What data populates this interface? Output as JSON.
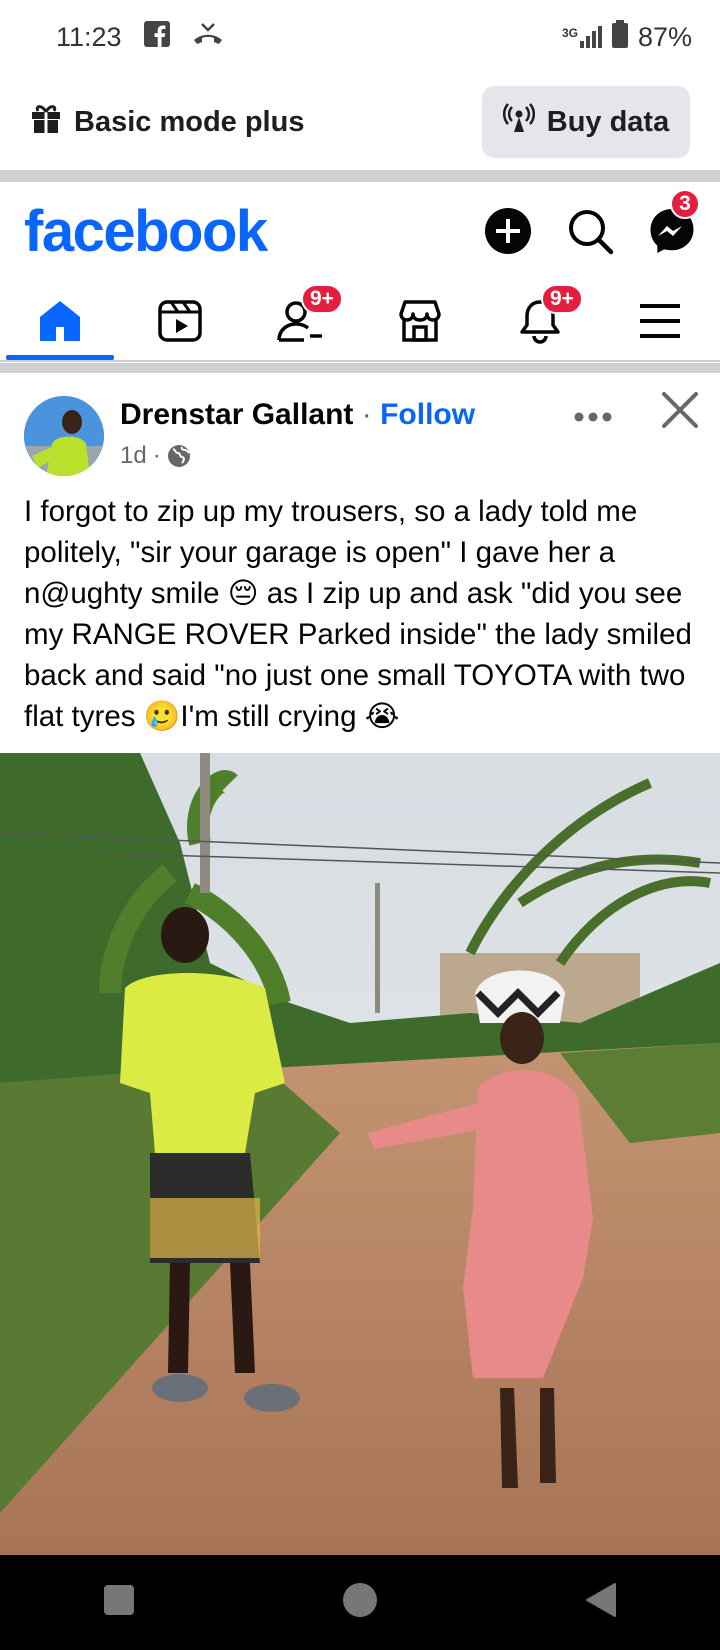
{
  "status_bar": {
    "time": "11:23",
    "network": "3G",
    "battery": "87%"
  },
  "mode_bar": {
    "label": "Basic mode plus",
    "buy_button": "Buy data"
  },
  "header": {
    "logo": "facebook",
    "messenger_badge": "3"
  },
  "nav": {
    "friends_badge": "9+",
    "notifications_badge": "9+"
  },
  "post": {
    "author": "Drenstar Gallant",
    "separator": "·",
    "follow": "Follow",
    "time": "1d",
    "time_separator": "·",
    "text": "I forgot to zip up my trousers, so a lady told me politely, \"sir your garage is open\" I gave her a n@ughty smile 😔 as I zip up and ask \"did you see my RANGE ROVER Parked inside\" the lady smiled back and said \"no just one small TOYOTA with two flat tyres 🥲I'm still crying 😭"
  },
  "colors": {
    "brand": "#0866ff",
    "badge": "#e41e3f",
    "secondary_text": "#65676b"
  }
}
